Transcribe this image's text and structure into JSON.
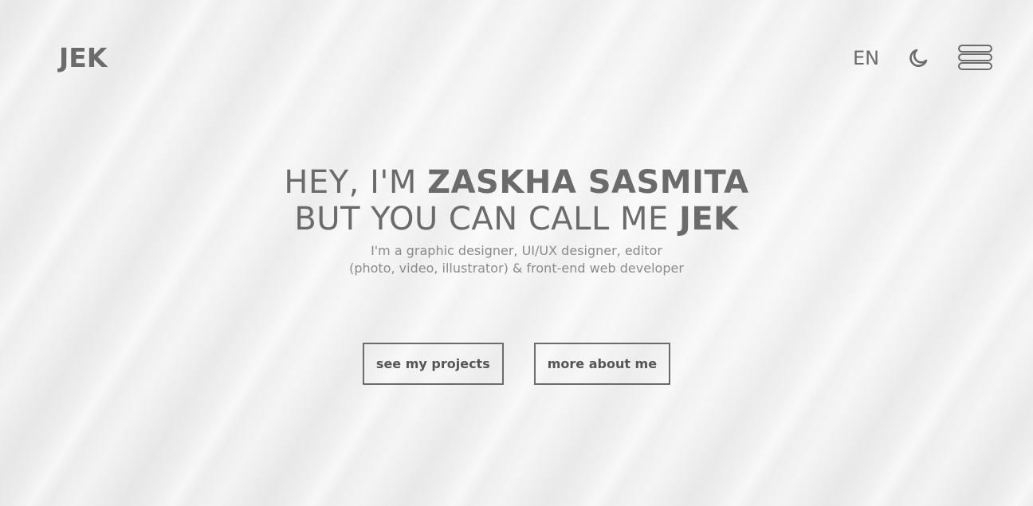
{
  "header": {
    "logo": "JEK",
    "language": "EN",
    "theme_icon": "moon-icon",
    "menu_icon": "hamburger-menu-icon"
  },
  "hero": {
    "line1_prefix": "HEY, I'M ",
    "line1_name": "ZASKHA SASMITA",
    "line2_prefix": "BUT YOU CAN CALL ME ",
    "line2_name": "JEK",
    "tagline": "I'm a graphic designer, UI/UX designer, editor (photo, video, illustrator) & front-end web developer"
  },
  "buttons": {
    "projects": "see my projects",
    "about": "more about me"
  },
  "colors": {
    "text": "#6b6b6b",
    "background": "#f1f1f1"
  }
}
